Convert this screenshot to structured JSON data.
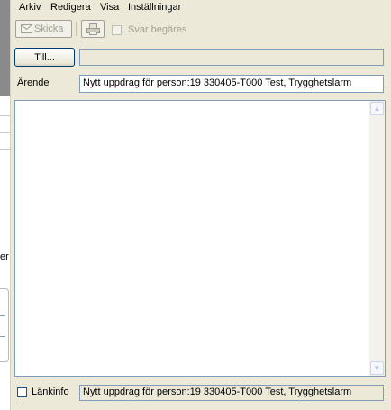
{
  "background_window": {
    "fragment_text": "er"
  },
  "menubar": {
    "items": [
      "Arkiv",
      "Redigera",
      "Visa",
      "Inställningar"
    ]
  },
  "toolbar": {
    "send_label": "Skicka",
    "send_icon": "envelope-icon",
    "print_icon": "printer-icon",
    "reply_requested_label": "Svar begäres",
    "reply_requested_checked": false
  },
  "to": {
    "button_label": "Till...",
    "value": ""
  },
  "subject": {
    "label": "Ärende",
    "value": "Nytt uppdrag för person:19 330405-T000 Test, Trygghetslarm"
  },
  "message": {
    "body": ""
  },
  "link": {
    "label": "Länkinfo",
    "checked": false,
    "value": "Nytt uppdrag för person:19 330405-T000 Test, Trygghetslarm"
  }
}
